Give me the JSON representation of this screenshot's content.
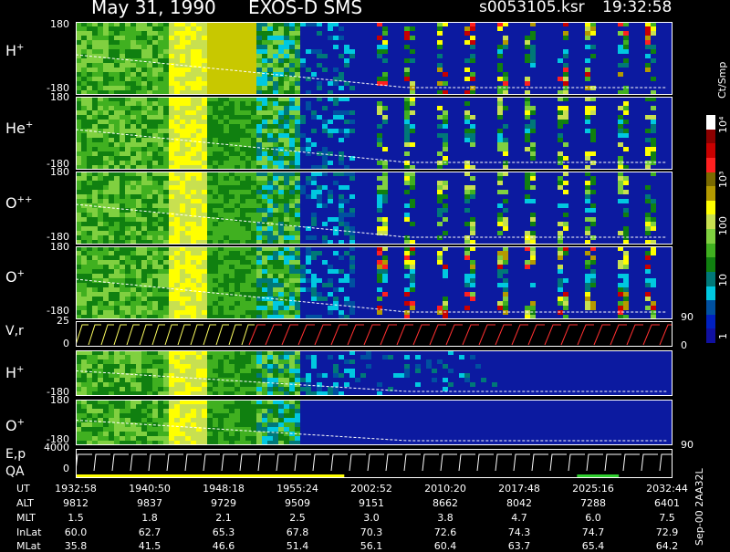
{
  "header": {
    "date": "May 31, 1990",
    "instrument": "EXOS-D SMS",
    "file": "s0053105.ksr",
    "time": "19:32:58"
  },
  "panels": [
    {
      "label": "H",
      "charge": "+",
      "ymax": "180",
      "ymin": "-180"
    },
    {
      "label": "He",
      "charge": "+",
      "ymax": "180",
      "ymin": "-180"
    },
    {
      "label": "O",
      "charge": "++",
      "ymax": "180",
      "ymin": "-180"
    },
    {
      "label": "O",
      "charge": "+",
      "ymax": "180",
      "ymin": "-180"
    },
    {
      "label": "V,r",
      "charge": "",
      "ymax": "25",
      "ymin": "0"
    },
    {
      "label": "H",
      "charge": "+",
      "ymax": "180",
      "ymin": "-180"
    },
    {
      "label": "O",
      "charge": "+",
      "ymax": "180",
      "ymin": "-180"
    },
    {
      "label": "E,p",
      "charge": "",
      "ymax": "4000",
      "ymin": "0"
    }
  ],
  "qa_label": "QA",
  "right_ticks": {
    "v_top": "90",
    "v_bottom": "0",
    "o_right": "90"
  },
  "colorbar": {
    "unit": "Ct/Smp",
    "labels": [
      "10⁴",
      "10³",
      "100",
      "10",
      "1"
    ],
    "colors": [
      "#ffffff",
      "#8c0000",
      "#c80000",
      "#ff2020",
      "#7a6a00",
      "#b49a00",
      "#ffff00",
      "#c8e050",
      "#80d040",
      "#40b020",
      "#108010",
      "#007878",
      "#00c8e0",
      "#0050a0",
      "#0020c0",
      "#1010a0"
    ]
  },
  "axis_rows": [
    {
      "name": "UT",
      "values": [
        "1932:58",
        "1940:50",
        "1948:18",
        "1955:24",
        "2002:52",
        "2010:20",
        "2017:48",
        "2025:16",
        "2032:44"
      ]
    },
    {
      "name": "ALT",
      "values": [
        "9812",
        "9837",
        "9729",
        "9509",
        "9151",
        "8662",
        "8042",
        "7288",
        "6401"
      ]
    },
    {
      "name": "MLT",
      "values": [
        "1.5",
        "1.8",
        "2.1",
        "2.5",
        "3.0",
        "3.8",
        "4.7",
        "6.0",
        "7.5"
      ]
    },
    {
      "name": "InLat",
      "values": [
        "60.0",
        "62.7",
        "65.3",
        "67.8",
        "70.3",
        "72.6",
        "74.3",
        "74.7",
        "72.9"
      ]
    },
    {
      "name": "MLat",
      "values": [
        "35.8",
        "41.5",
        "46.6",
        "51.4",
        "56.1",
        "60.4",
        "63.7",
        "65.4",
        "64.2"
      ]
    }
  ],
  "side_text": "Sep-00 2AA32L",
  "chart_data": {
    "type": "heatmap",
    "title": "May 31, 1990   EXOS-D SMS",
    "x": [
      "1932:58",
      "1940:50",
      "1948:18",
      "1955:24",
      "2002:52",
      "2010:20",
      "2017:48",
      "2025:16",
      "2032:44"
    ],
    "panels": [
      "H+",
      "He+",
      "O++",
      "O+",
      "V,r",
      "H+",
      "O+",
      "E,p"
    ],
    "ylim_pitch": [
      -180,
      180
    ],
    "colorbar_unit": "Ct/Smp",
    "colorbar_range": [
      1,
      10000
    ],
    "log_scale": true
  }
}
